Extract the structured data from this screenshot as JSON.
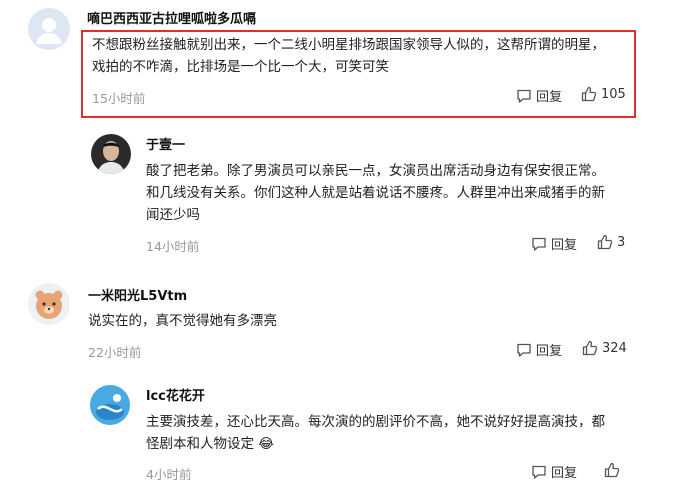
{
  "comments": [
    {
      "username": "嘀巴西西亚古拉哩呱啦多瓜嗝",
      "text_lines": [
        "不想跟粉丝接触就别出来，一个二线小明星排场跟国家领导人似的，这帮所谓的明星，",
        "戏拍的不咋滴，比排场是一个比一个大，可笑可笑"
      ],
      "time": "15小时前",
      "reply_label": "回复",
      "likes": "105",
      "highlight_color": "#e0302b"
    },
    {
      "username": "于壹一",
      "text_lines": [
        "酸了把老弟。除了男演员可以亲民一点，女演员出席活动身边有保安很正常。",
        "和几线没有关系。你们这种人就是站着说话不腰疼。人群里冲出来咸猪手的新",
        "闻还少吗"
      ],
      "time": "14小时前",
      "reply_label": "回复",
      "likes": "3"
    },
    {
      "username": "一米阳光L5Vtm",
      "text_lines": [
        "说实在的，真不觉得她有多漂亮"
      ],
      "time": "22小时前",
      "reply_label": "回复",
      "likes": "324"
    },
    {
      "username": "lcc花花开",
      "text_lines": [
        "主要演技差，还心比天高。每次演的的剧评价不高，她不说好好提高演技，都",
        "怪剧本和人物设定"
      ],
      "emoji": "😂",
      "time": "4小时前",
      "reply_label": "回复",
      "likes": ""
    }
  ],
  "icons": {
    "reply": "comment-bubble-icon",
    "like": "thumbs-up-icon"
  }
}
